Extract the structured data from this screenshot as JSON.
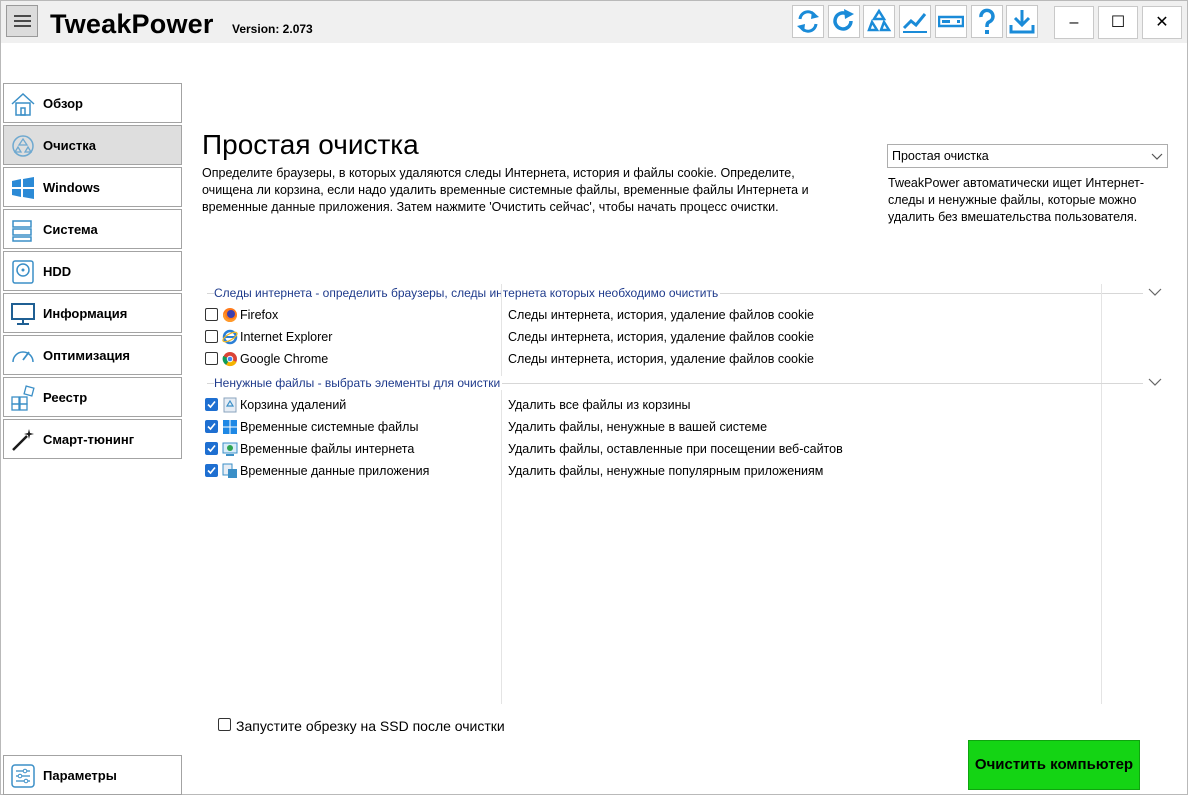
{
  "app": {
    "title": "TweakPower",
    "version": "Version: 2.073"
  },
  "toolbar": {
    "icons": [
      "refresh-icon",
      "redo-icon",
      "recycle-icon",
      "chart-icon",
      "drive-icon",
      "help-icon",
      "download-icon"
    ],
    "window": {
      "minimize": "–",
      "maximize": "☐",
      "close": "✕"
    }
  },
  "sidebar": {
    "items": [
      {
        "label": "Обзор",
        "icon": "home-icon",
        "active": false
      },
      {
        "label": "Очистка",
        "icon": "recycle-icon",
        "active": true
      },
      {
        "label": "Windows",
        "icon": "windows-icon",
        "active": false
      },
      {
        "label": "Система",
        "icon": "system-icon",
        "active": false
      },
      {
        "label": "HDD",
        "icon": "hdd-icon",
        "active": false
      },
      {
        "label": "Информация",
        "icon": "monitor-icon",
        "active": false
      },
      {
        "label": "Оптимизация",
        "icon": "gauge-icon",
        "active": false
      },
      {
        "label": "Реестр",
        "icon": "registry-icon",
        "active": false
      },
      {
        "label": "Смарт-тюнинг",
        "icon": "wand-icon",
        "active": false
      }
    ],
    "settings": {
      "label": "Параметры",
      "icon": "sliders-icon"
    }
  },
  "main": {
    "title": "Простая очистка",
    "description": "Определите браузеры, в которых удаляются следы Интернета, история и файлы cookie. Определите, очищена ли корзина, если надо удалить временные системные файлы, временные файлы Интернета и временные данные приложения. Затем нажмите 'Очистить сейчас', чтобы начать процесс очистки.",
    "mode_select": {
      "value": "Простая очистка"
    },
    "mode_description": "TweakPower автоматически ищет Интернет-следы и ненужные файлы, которые можно удалить без вмешательства пользователя.",
    "groups": [
      {
        "title": "Следы интернета - определить браузеры, следы интернета которых необходимо очистить",
        "items": [
          {
            "name": "Firefox",
            "desc": "Следы интернета, история, удаление файлов cookie",
            "checked": false,
            "icon": "firefox-icon"
          },
          {
            "name": "Internet Explorer",
            "desc": "Следы интернета, история, удаление файлов cookie",
            "checked": false,
            "icon": "ie-icon"
          },
          {
            "name": "Google Chrome",
            "desc": "Следы интернета, история, удаление файлов cookie",
            "checked": false,
            "icon": "chrome-icon"
          }
        ]
      },
      {
        "title": "Ненужные файлы - выбрать элементы для очистки",
        "items": [
          {
            "name": "Корзина удалений",
            "desc": "Удалить все файлы из корзины",
            "checked": true,
            "icon": "recycle-bin-icon"
          },
          {
            "name": "Временные системные файлы",
            "desc": "Удалить файлы, ненужные в вашей системе",
            "checked": true,
            "icon": "windows-icon"
          },
          {
            "name": "Временные файлы интернета",
            "desc": "Удалить файлы, оставленные при посещении веб-сайтов",
            "checked": true,
            "icon": "web-files-icon"
          },
          {
            "name": "Временные данные приложения",
            "desc": "Удалить файлы, ненужные популярным приложениям",
            "checked": true,
            "icon": "app-data-icon"
          }
        ]
      }
    ],
    "ssd_option": {
      "label": "Запустите обрезку на SSD после очистки",
      "checked": false
    },
    "clean_button": "Очистить компьютер"
  }
}
